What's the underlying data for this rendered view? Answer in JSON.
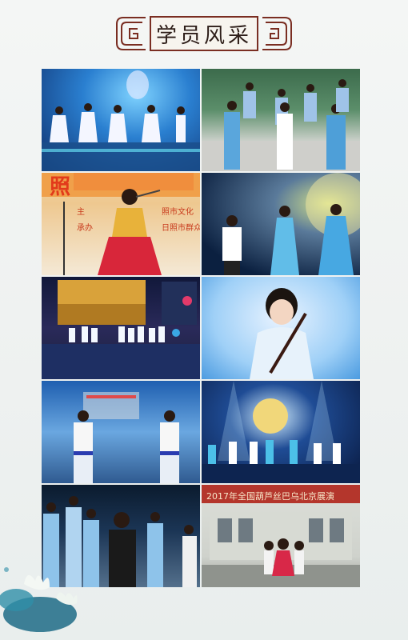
{
  "header": {
    "title": "学员风采"
  },
  "photos": [
    {
      "id": "p1",
      "overlay_text": ""
    },
    {
      "id": "p2",
      "overlay_text": ""
    },
    {
      "id": "p3",
      "overlay_text": "照"
    },
    {
      "id": "p4",
      "overlay_text": ""
    },
    {
      "id": "p5",
      "overlay_text": ""
    },
    {
      "id": "p6",
      "overlay_text": ""
    },
    {
      "id": "p7",
      "overlay_text": ""
    },
    {
      "id": "p8",
      "overlay_text": ""
    },
    {
      "id": "p9",
      "overlay_text": ""
    },
    {
      "id": "p10",
      "overlay_text": "2017年全国葫芦丝巴乌北京展演"
    }
  ],
  "photo3_banner": {
    "line1": "主",
    "line1b": "照市文化",
    "line2": "承办",
    "line2b": "日照市群众"
  },
  "colors": {
    "title_border": "#7a2e22",
    "background": "#eef1f0",
    "banner_red": "#b4362c"
  }
}
